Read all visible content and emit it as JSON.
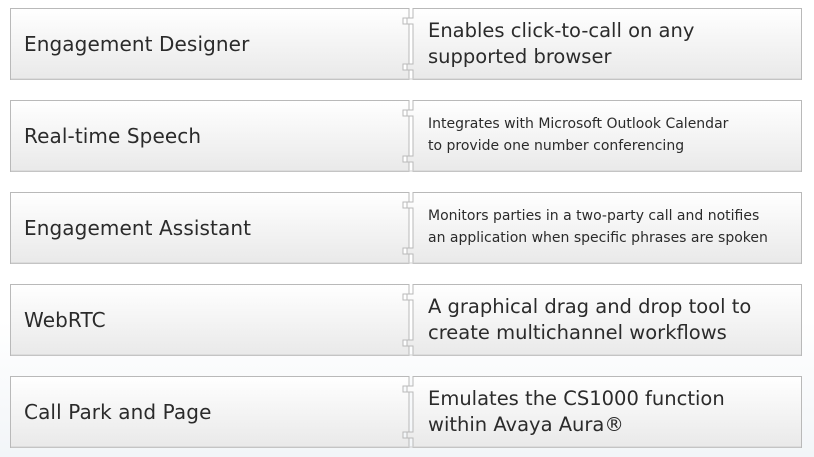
{
  "rows": [
    {
      "left_label": "Engagement Designer",
      "right_text": "Enables click-to-call on any\nsupported browser",
      "size": "large"
    },
    {
      "left_label": "Real-time Speech",
      "right_text": "Integrates with Microsoft Outlook Calendar\nto provide one number conferencing",
      "size": "small"
    },
    {
      "left_label": "Engagement Assistant",
      "right_text": "Monitors parties in a two-party call and notifies\nan application when specific phrases are spoken",
      "size": "small"
    },
    {
      "left_label": "WebRTC",
      "right_text": "A graphical drag and drop tool to\ncreate multichannel workflows",
      "size": "large"
    },
    {
      "left_label": "Call Park and Page",
      "right_text": "Emulates the CS1000 function\nwithin Avaya Aura®",
      "size": "large"
    }
  ],
  "colors": {
    "border": "#b9b9b9",
    "fill_top": "#ffffff",
    "fill_bottom": "#e9e9e9",
    "text": "#2b2b2b"
  }
}
